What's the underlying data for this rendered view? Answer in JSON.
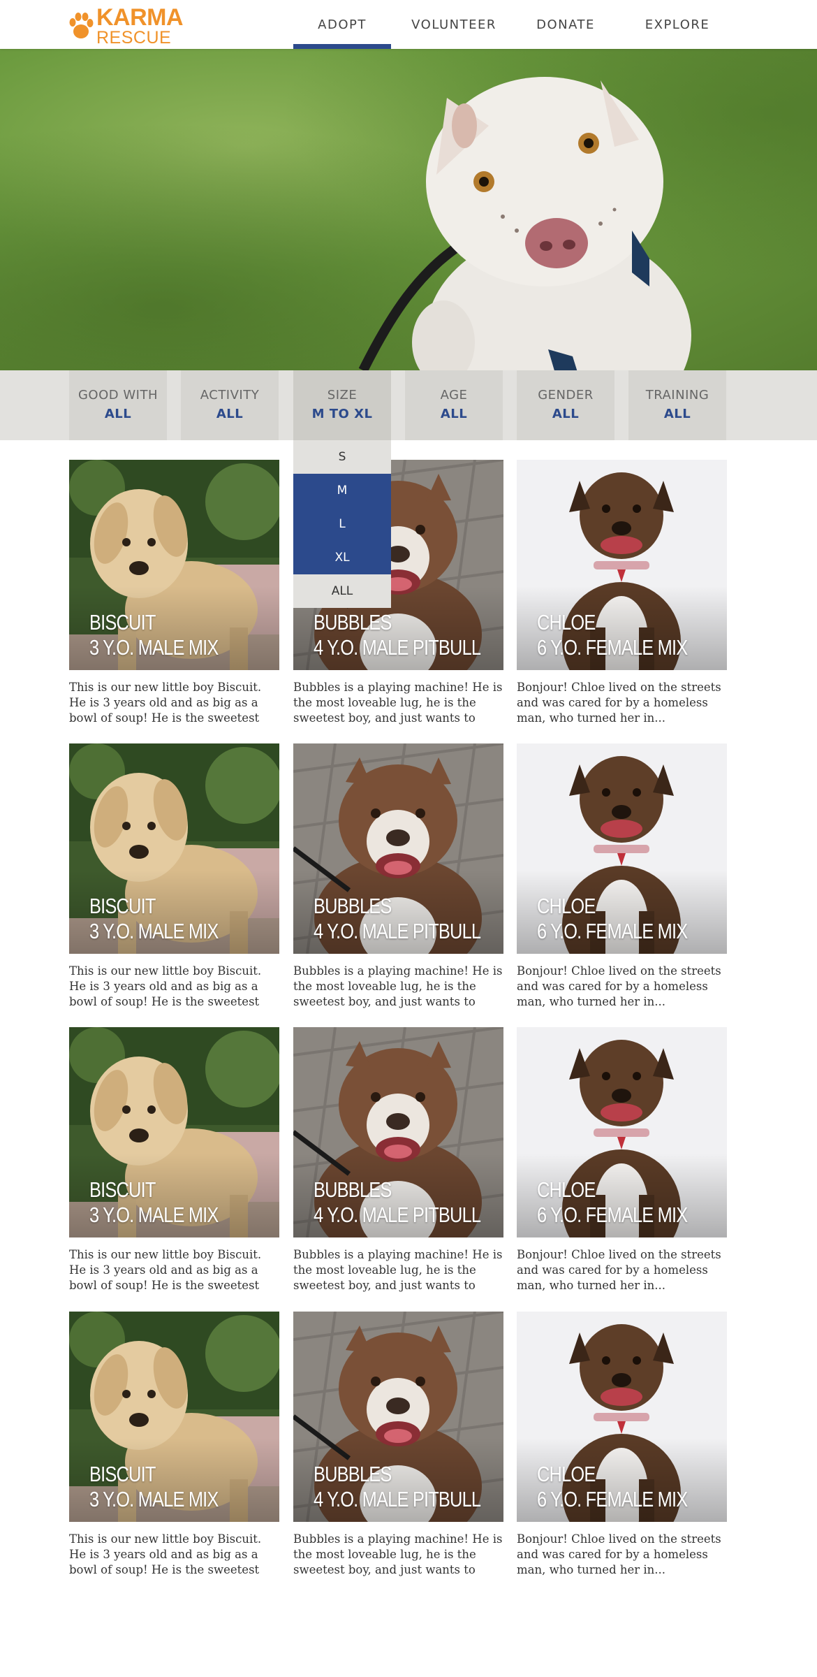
{
  "brand": {
    "name_top": "KARMA",
    "name_bottom": "RESCUE",
    "color": "#f0922a"
  },
  "nav": {
    "items": [
      {
        "label": "ADOPT",
        "active": true
      },
      {
        "label": "VOLUNTEER",
        "active": false
      },
      {
        "label": "DONATE",
        "active": false
      },
      {
        "label": "EXPLORE",
        "active": false
      }
    ],
    "accent": "#2c4a8c"
  },
  "filters": [
    {
      "label": "GOOD WITH",
      "value": "ALL"
    },
    {
      "label": "ACTIVITY",
      "value": "ALL"
    },
    {
      "label": "SIZE",
      "value": "M TO XL"
    },
    {
      "label": "AGE",
      "value": "ALL"
    },
    {
      "label": "GENDER",
      "value": "ALL"
    },
    {
      "label": "TRAINING",
      "value": "ALL"
    }
  ],
  "size_dropdown": {
    "options": [
      {
        "label": "S",
        "selected": false
      },
      {
        "label": "M",
        "selected": true
      },
      {
        "label": "L",
        "selected": true
      },
      {
        "label": "XL",
        "selected": true
      },
      {
        "label": "ALL",
        "selected": false
      }
    ]
  },
  "dogs": [
    {
      "name": "BISCUIT",
      "meta": "3 Y.O. MALE MIX",
      "description": "This is our new little boy Biscuit. He is 3 years old and as big as a bowl of soup!  He is the sweetest little guy...",
      "photo_icon": "fluffy-tan-dog-photo"
    },
    {
      "name": "BUBBLES",
      "meta": "4 Y.O. MALE PITBULL",
      "description": "Bubbles is a playing machine! He is the most loveable lug, he is the sweetest boy, and just wants to play...",
      "photo_icon": "brown-white-pitbull-photo"
    },
    {
      "name": "CHLOE",
      "meta": "6 Y.O. FEMALE MIX",
      "description": "Bonjour! Chloe lived on the streets and was cared for by a homeless man, who turned her in...",
      "photo_icon": "brindle-dog-photo"
    },
    {
      "name": "BISCUIT",
      "meta": "3 Y.O. MALE MIX",
      "description": "This is our new little boy Biscuit. He is 3 years old and as big as a bowl of soup!  He is the sweetest little guy...",
      "photo_icon": "fluffy-tan-dog-photo"
    },
    {
      "name": "BUBBLES",
      "meta": "4 Y.O. MALE PITBULL",
      "description": "Bubbles is a playing machine! He is the most loveable lug, he is the sweetest boy, and just wants to play...",
      "photo_icon": "brown-white-pitbull-photo"
    },
    {
      "name": "CHLOE",
      "meta": "6 Y.O. FEMALE MIX",
      "description": "Bonjour! Chloe lived on the streets and was cared for by a homeless man, who turned her in...",
      "photo_icon": "brindle-dog-photo"
    },
    {
      "name": "BISCUIT",
      "meta": "3 Y.O. MALE MIX",
      "description": "This is our new little boy Biscuit. He is 3 years old and as big as a bowl of soup!  He is the sweetest little guy...",
      "photo_icon": "fluffy-tan-dog-photo"
    },
    {
      "name": "BUBBLES",
      "meta": "4 Y.O. MALE PITBULL",
      "description": "Bubbles is a playing machine! He is the most loveable lug, he is the sweetest boy, and just wants to play...",
      "photo_icon": "brown-white-pitbull-photo"
    },
    {
      "name": "CHLOE",
      "meta": "6 Y.O. FEMALE MIX",
      "description": "Bonjour! Chloe lived on the streets and was cared for by a homeless man, who turned her in...",
      "photo_icon": "brindle-dog-photo"
    },
    {
      "name": "BISCUIT",
      "meta": "3 Y.O. MALE MIX",
      "description": "This is our new little boy Biscuit. He is 3 years old and as big as a bowl of soup!  He is the sweetest little guy...",
      "photo_icon": "fluffy-tan-dog-photo"
    },
    {
      "name": "BUBBLES",
      "meta": "4 Y.O. MALE PITBULL",
      "description": "Bubbles is a playing machine! He is the most loveable lug, he is the sweetest boy, and just wants to play...",
      "photo_icon": "brown-white-pitbull-photo"
    },
    {
      "name": "CHLOE",
      "meta": "6 Y.O. FEMALE MIX",
      "description": "Bonjour! Chloe lived on the streets and was cared for by a homeless man, who turned her in...",
      "photo_icon": "brindle-dog-photo"
    }
  ],
  "hero": {
    "photo_icon": "white-pitbull-hero-photo"
  }
}
